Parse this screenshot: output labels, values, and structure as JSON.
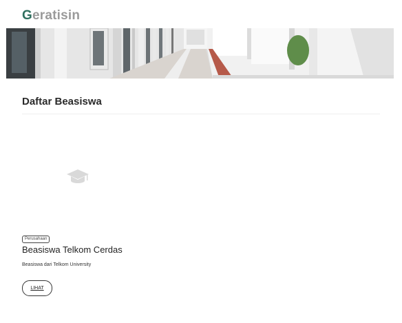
{
  "brand": {
    "first_letter": "G",
    "rest": "eratisin"
  },
  "hero": {
    "icon": "corridor-banner-image"
  },
  "section": {
    "title": "Daftar Beasiswa"
  },
  "cards": [
    {
      "image_icon": "graduation-cap-icon",
      "badge": "Perusahaan",
      "title": "Beasiswa Telkom Cerdas",
      "description": "Beasiswa dari Telkom University",
      "button_label": "LIHAT"
    }
  ],
  "colors": {
    "brand_accent": "#2f6f5e",
    "brand_muted": "#9a9a9a",
    "divider": "#efefef"
  }
}
